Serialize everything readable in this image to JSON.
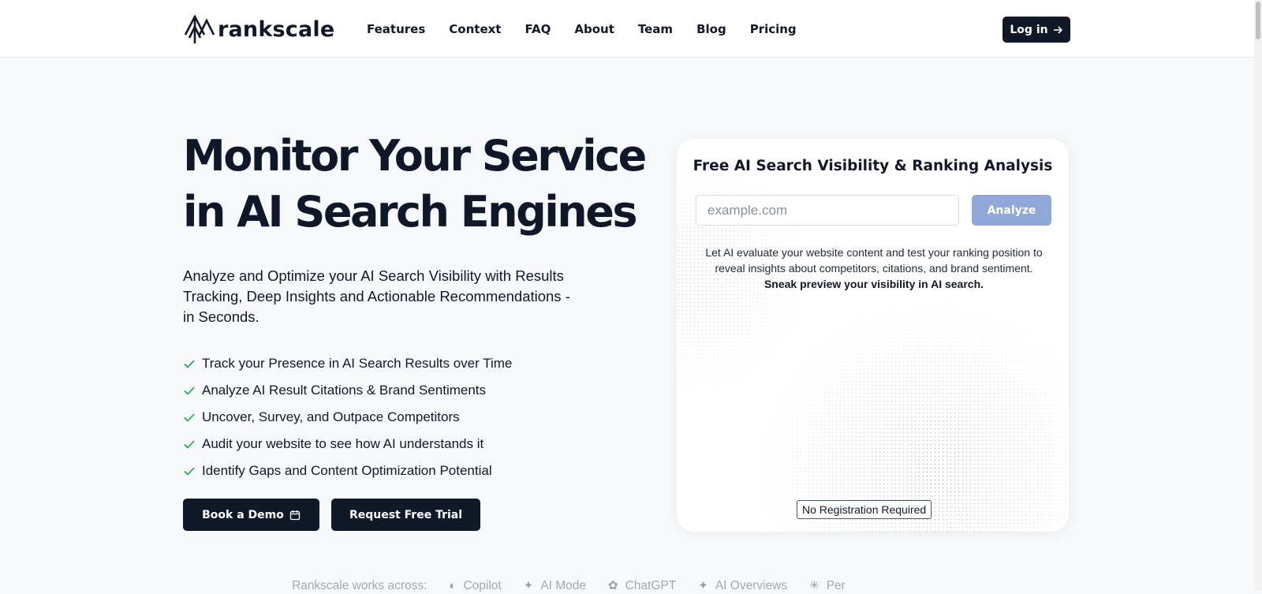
{
  "brand": {
    "name": "rankscale",
    "logo_icon": "tree-arrow-icon"
  },
  "nav": {
    "items": [
      "Features",
      "Context",
      "FAQ",
      "About",
      "Team",
      "Blog",
      "Pricing"
    ],
    "login_label": "Log in"
  },
  "hero": {
    "title_line1": "Monitor Your Service",
    "title_line2": "in AI Search Engines",
    "subtitle": "Analyze and Optimize your AI Search Visibility with Results Tracking, Deep Insights and Actionable Recommendations - in Seconds.",
    "features": [
      "Track your Presence in AI Search Results over Time",
      "Analyze AI Result Citations & Brand Sentiments",
      "Uncover, Survey, and Outpace Competitors",
      "Audit your website to see how AI understands it",
      "Identify Gaps and Content Optimization Potential"
    ],
    "demo_label": "Book a Demo",
    "trial_label": "Request Free Trial"
  },
  "card": {
    "title": "Free AI Search Visibility & Ranking Analysis",
    "input_placeholder": "example.com",
    "input_value": "",
    "analyze_label": "Analyze",
    "description": "Let AI evaluate your website content and test your ranking position to reveal insights about competitors, citations, and brand sentiment.",
    "description_bold": "Sneak preview your visibility in AI search.",
    "badge": "No Registration Required"
  },
  "works_across": {
    "label": "Rankscale works across:",
    "items": [
      {
        "name": "Copilot",
        "icon": "copilot-icon"
      },
      {
        "name": "AI Mode",
        "icon": "sparkle-icon"
      },
      {
        "name": "ChatGPT",
        "icon": "chatgpt-icon"
      },
      {
        "name": "AI Overviews",
        "icon": "sparkle-icon"
      },
      {
        "name": "Per",
        "icon": "perplexity-icon"
      }
    ]
  },
  "colors": {
    "primary": "#111827",
    "accent_button": "#8fa8d8",
    "check": "#16a34a",
    "background": "#f7f8fa"
  }
}
